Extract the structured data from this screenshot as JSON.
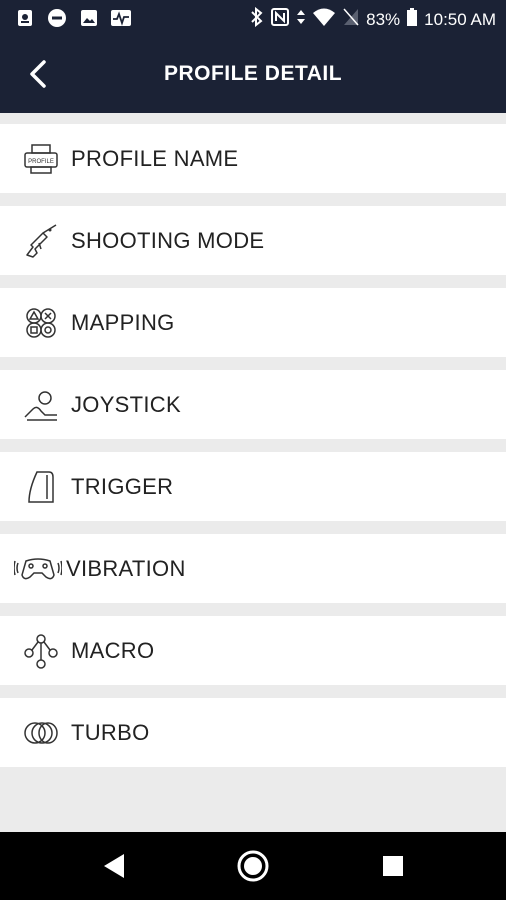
{
  "status_bar": {
    "battery_percent": "83%",
    "time": "10:50 AM",
    "left_icons": [
      "settings-icon",
      "dnd-icon",
      "image-icon",
      "pulse-icon"
    ],
    "right_icons": [
      "bluetooth-icon",
      "nfc-icon",
      "data-icon",
      "wifi-icon",
      "no-sim-icon",
      "battery-icon"
    ]
  },
  "app_bar": {
    "title": "PROFILE DETAIL",
    "back_icon": "chevron-left-icon"
  },
  "menu": {
    "items": [
      {
        "label": "PROFILE NAME",
        "icon": "printer-icon",
        "icon_text": "PROFILE"
      },
      {
        "label": "SHOOTING MODE",
        "icon": "rifle-icon"
      },
      {
        "label": "MAPPING",
        "icon": "buttons-icon"
      },
      {
        "label": "JOYSTICK",
        "icon": "joystick-icon"
      },
      {
        "label": "TRIGGER",
        "icon": "trigger-icon"
      },
      {
        "label": "VIBRATION",
        "icon": "vibration-icon"
      },
      {
        "label": "MACRO",
        "icon": "macro-icon"
      },
      {
        "label": "TURBO",
        "icon": "turbo-icon"
      }
    ]
  },
  "nav_bar": {
    "buttons": [
      "back-icon",
      "home-icon",
      "recents-icon"
    ]
  },
  "colors": {
    "header": "#1b2235",
    "background": "#ebebeb",
    "row": "#ffffff",
    "text": "#222222"
  }
}
